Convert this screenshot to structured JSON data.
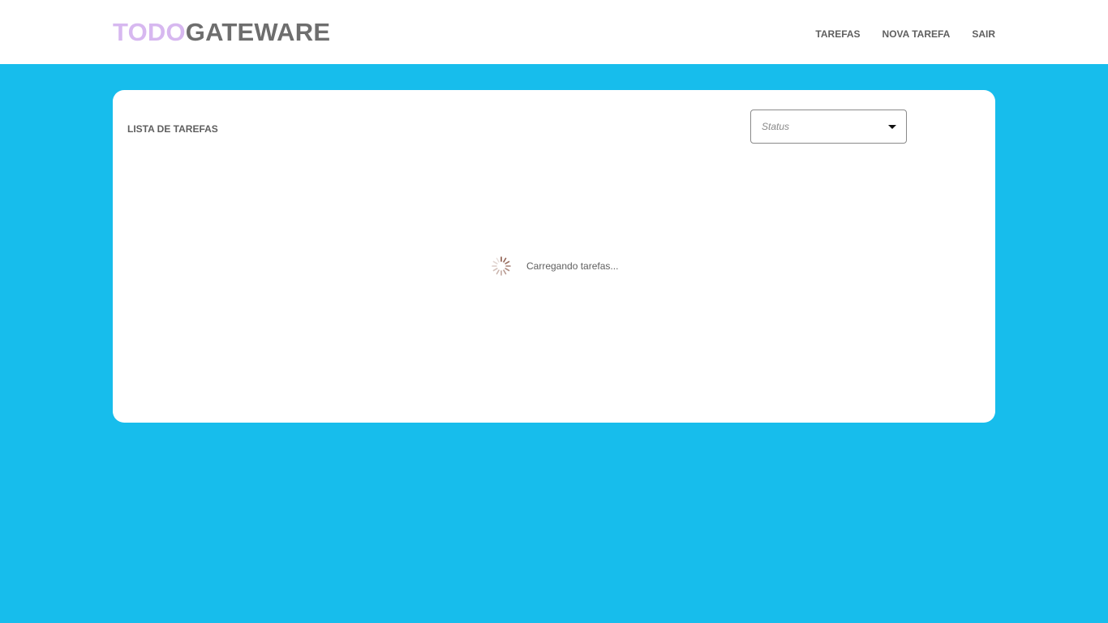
{
  "header": {
    "logo_part1": "TODO",
    "logo_part2": "GATEWARE",
    "logo_colors": {
      "part1": "#d7b8f0",
      "part2": "#6e6e6e"
    },
    "nav": {
      "tasks": "TAREFAS",
      "new_task": "NOVA TAREFA",
      "logout": "SAIR"
    }
  },
  "main": {
    "title": "LISTA DE TAREFAS",
    "status_filter": {
      "placeholder": "Status",
      "icon": "caret-down-icon"
    },
    "loading": {
      "icon": "spinner-icon",
      "text": "Carregando tarefas..."
    }
  },
  "colors": {
    "background": "#17bdec",
    "card": "#ffffff",
    "text": "#5f5f5f",
    "spinner": "#8b5a4a"
  }
}
